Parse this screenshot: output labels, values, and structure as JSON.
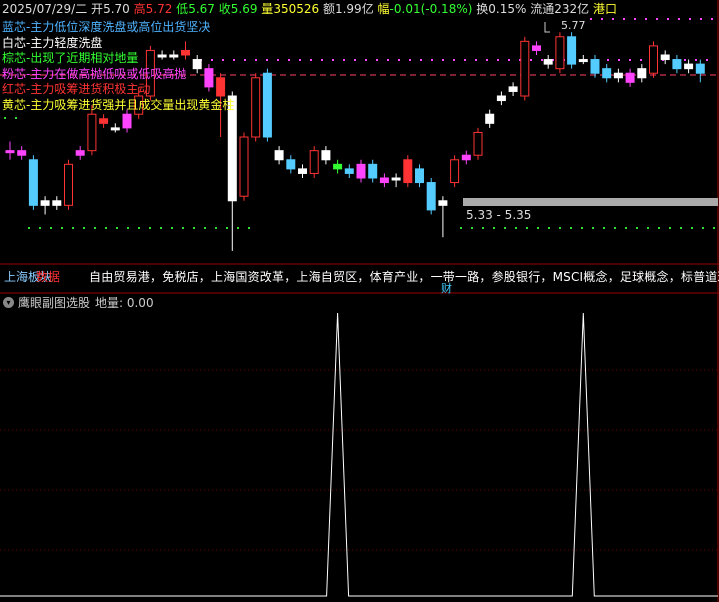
{
  "topbar": {
    "date": "2025/07/29/二",
    "open_label": "开",
    "open": "5.70",
    "high_label": "高",
    "high": "5.72",
    "low_label": "低",
    "low": "5.67",
    "close_label": "收",
    "close": "5.69",
    "volume_label": "量",
    "volume": "350526",
    "amount_label": "额",
    "amount": "1.99亿",
    "change_label": "幅",
    "change": "-0.01(-0.18%)",
    "turnover_label": "换",
    "turnover": "0.15%",
    "float_label": "流通",
    "float": "232亿",
    "stock_name": "港口"
  },
  "legend": [
    {
      "text": "蓝芯-主力低位深度洗盘或高位出货坚决",
      "color": "#4fb3ff"
    },
    {
      "text": "白芯-主力轻度洗盘",
      "color": "#ffffff"
    },
    {
      "text": "棕芯-出现了近期相对地量",
      "color": "#33ff33"
    },
    {
      "text": "粉芯-主力在做高抛低吸或低吸高抛",
      "color": "#ff44ff"
    },
    {
      "text": "红芯-主力吸筹进货积极主动",
      "color": "#ff3333"
    },
    {
      "text": "黄芯-主力吸筹进货强并且成交量出现黄金柱",
      "color": "#ffff33"
    }
  ],
  "annotations": {
    "high_marker": "5.77",
    "range_label": "5.33 - 5.35"
  },
  "concept_bar": {
    "sector": "上海板块",
    "sector_tag": "数据",
    "concepts": "自由贸易港，免税店，上海国资改革，上海自贸区，体育产业，一带一路，参股银行，MSCI概念，足球概念，标普道琼",
    "tail": "财"
  },
  "subchart": {
    "title": "鹰眼副图选股",
    "value_label": "地量: 0.00",
    "peaks_at_candle": [
      28,
      49
    ],
    "baseline": 0,
    "peak": 1
  },
  "candles": [
    {
      "o": 5.52,
      "c": 5.52,
      "h": 5.54,
      "l": 5.5,
      "col": "pink"
    },
    {
      "o": 5.52,
      "c": 5.51,
      "h": 5.53,
      "l": 5.5,
      "col": "pink"
    },
    {
      "o": 5.5,
      "c": 5.4,
      "h": 5.51,
      "l": 5.39,
      "col": "blue"
    },
    {
      "o": 5.4,
      "c": 5.41,
      "h": 5.42,
      "l": 5.38,
      "col": "white"
    },
    {
      "o": 5.4,
      "c": 5.41,
      "h": 5.42,
      "l": 5.39,
      "col": "white"
    },
    {
      "o": 5.4,
      "c": 5.49,
      "h": 5.5,
      "l": 5.39,
      "col": "red"
    },
    {
      "o": 5.51,
      "c": 5.52,
      "h": 5.53,
      "l": 5.5,
      "col": "pink"
    },
    {
      "o": 5.52,
      "c": 5.6,
      "h": 5.62,
      "l": 5.51,
      "col": "red"
    },
    {
      "o": 5.59,
      "c": 5.58,
      "h": 5.6,
      "l": 5.57,
      "col": "red"
    },
    {
      "o": 5.57,
      "c": 5.57,
      "h": 5.58,
      "l": 5.56,
      "col": "white"
    },
    {
      "o": 5.57,
      "c": 5.6,
      "h": 5.61,
      "l": 5.56,
      "col": "pink"
    },
    {
      "o": 5.6,
      "c": 5.64,
      "h": 5.66,
      "l": 5.59,
      "col": "red"
    },
    {
      "o": 5.64,
      "c": 5.74,
      "h": 5.75,
      "l": 5.63,
      "col": "red"
    },
    {
      "o": 5.73,
      "c": 5.73,
      "h": 5.74,
      "l": 5.72,
      "col": "white"
    },
    {
      "o": 5.73,
      "c": 5.73,
      "h": 5.74,
      "l": 5.72,
      "col": "white"
    },
    {
      "o": 5.74,
      "c": 5.73,
      "h": 5.76,
      "l": 5.72,
      "col": "red"
    },
    {
      "o": 5.72,
      "c": 5.7,
      "h": 5.73,
      "l": 5.69,
      "col": "white"
    },
    {
      "o": 5.7,
      "c": 5.66,
      "h": 5.71,
      "l": 5.65,
      "col": "pink"
    },
    {
      "o": 5.68,
      "c": 5.64,
      "h": 5.69,
      "l": 5.55,
      "col": "red"
    },
    {
      "o": 5.64,
      "c": 5.41,
      "h": 5.65,
      "l": 5.3,
      "col": "white"
    },
    {
      "o": 5.42,
      "c": 5.55,
      "h": 5.56,
      "l": 5.41,
      "col": "red"
    },
    {
      "o": 5.55,
      "c": 5.68,
      "h": 5.69,
      "l": 5.54,
      "col": "red"
    },
    {
      "o": 5.69,
      "c": 5.55,
      "h": 5.7,
      "l": 5.54,
      "col": "blue"
    },
    {
      "o": 5.52,
      "c": 5.5,
      "h": 5.53,
      "l": 5.49,
      "col": "white"
    },
    {
      "o": 5.5,
      "c": 5.48,
      "h": 5.51,
      "l": 5.47,
      "col": "blue"
    },
    {
      "o": 5.48,
      "c": 5.47,
      "h": 5.49,
      "l": 5.46,
      "col": "white"
    },
    {
      "o": 5.47,
      "c": 5.52,
      "h": 5.53,
      "l": 5.46,
      "col": "red"
    },
    {
      "o": 5.52,
      "c": 5.5,
      "h": 5.53,
      "l": 5.49,
      "col": "white"
    },
    {
      "o": 5.48,
      "c": 5.49,
      "h": 5.5,
      "l": 5.47,
      "col": "green"
    },
    {
      "o": 5.48,
      "c": 5.47,
      "h": 5.49,
      "l": 5.46,
      "col": "blue"
    },
    {
      "o": 5.49,
      "c": 5.46,
      "h": 5.5,
      "l": 5.45,
      "col": "pink"
    },
    {
      "o": 5.49,
      "c": 5.46,
      "h": 5.5,
      "l": 5.45,
      "col": "blue"
    },
    {
      "o": 5.46,
      "c": 5.45,
      "h": 5.47,
      "l": 5.44,
      "col": "pink"
    },
    {
      "o": 5.46,
      "c": 5.46,
      "h": 5.47,
      "l": 5.44,
      "col": "white"
    },
    {
      "o": 5.5,
      "c": 5.45,
      "h": 5.51,
      "l": 5.44,
      "col": "red"
    },
    {
      "o": 5.48,
      "c": 5.45,
      "h": 5.49,
      "l": 5.44,
      "col": "blue"
    },
    {
      "o": 5.45,
      "c": 5.39,
      "h": 5.46,
      "l": 5.38,
      "col": "blue"
    },
    {
      "o": 5.4,
      "c": 5.41,
      "h": 5.42,
      "l": 5.33,
      "col": "white"
    },
    {
      "o": 5.45,
      "c": 5.5,
      "h": 5.51,
      "l": 5.44,
      "col": "red"
    },
    {
      "o": 5.5,
      "c": 5.51,
      "h": 5.52,
      "l": 5.49,
      "col": "pink"
    },
    {
      "o": 5.51,
      "c": 5.56,
      "h": 5.57,
      "l": 5.5,
      "col": "red"
    },
    {
      "o": 5.58,
      "c": 5.6,
      "h": 5.61,
      "l": 5.57,
      "col": "white"
    },
    {
      "o": 5.63,
      "c": 5.64,
      "h": 5.65,
      "l": 5.62,
      "col": "white"
    },
    {
      "o": 5.66,
      "c": 5.65,
      "h": 5.67,
      "l": 5.64,
      "col": "white"
    },
    {
      "o": 5.64,
      "c": 5.76,
      "h": 5.77,
      "l": 5.63,
      "col": "red"
    },
    {
      "o": 5.75,
      "c": 5.74,
      "h": 5.76,
      "l": 5.73,
      "col": "pink"
    },
    {
      "o": 5.72,
      "c": 5.71,
      "h": 5.73,
      "l": 5.7,
      "col": "white"
    },
    {
      "o": 5.7,
      "c": 5.77,
      "h": 5.78,
      "l": 5.69,
      "col": "red"
    },
    {
      "o": 5.77,
      "c": 5.71,
      "h": 5.78,
      "l": 5.7,
      "col": "blue"
    },
    {
      "o": 5.72,
      "c": 5.72,
      "h": 5.73,
      "l": 5.71,
      "col": "white"
    },
    {
      "o": 5.72,
      "c": 5.69,
      "h": 5.73,
      "l": 5.68,
      "col": "blue"
    },
    {
      "o": 5.7,
      "c": 5.68,
      "h": 5.71,
      "l": 5.67,
      "col": "blue"
    },
    {
      "o": 5.69,
      "c": 5.68,
      "h": 5.7,
      "l": 5.67,
      "col": "white"
    },
    {
      "o": 5.69,
      "c": 5.67,
      "h": 5.7,
      "l": 5.66,
      "col": "pink"
    },
    {
      "o": 5.68,
      "c": 5.7,
      "h": 5.71,
      "l": 5.67,
      "col": "white"
    },
    {
      "o": 5.69,
      "c": 5.75,
      "h": 5.76,
      "l": 5.68,
      "col": "red"
    },
    {
      "o": 5.72,
      "c": 5.73,
      "h": 5.74,
      "l": 5.71,
      "col": "white"
    },
    {
      "o": 5.72,
      "c": 5.7,
      "h": 5.73,
      "l": 5.69,
      "col": "blue"
    },
    {
      "o": 5.7,
      "c": 5.71,
      "h": 5.72,
      "l": 5.69,
      "col": "white"
    },
    {
      "o": 5.71,
      "c": 5.69,
      "h": 5.72,
      "l": 5.67,
      "col": "blue"
    }
  ],
  "colors": {
    "red": "#ff3333",
    "blue": "#55ccff",
    "white": "#ffffff",
    "pink": "#ff44ff",
    "green": "#33ff33",
    "dotted_red": "#ff4466",
    "dotted_magenta": "#ff44ff",
    "dotted_green": "#33dd33",
    "grid": "#6a0000",
    "divider": "#990000"
  }
}
